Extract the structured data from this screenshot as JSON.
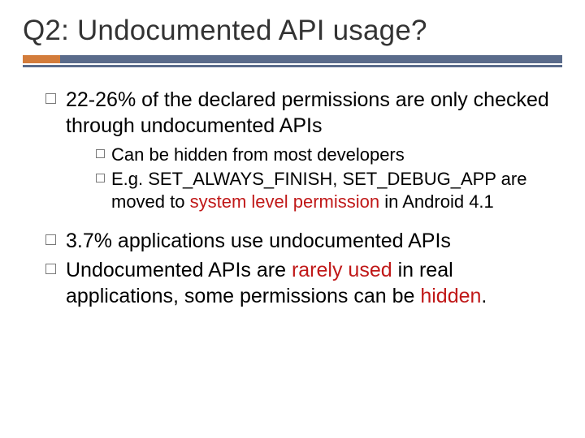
{
  "title": "Q2: Undocumented API usage?",
  "items": [
    {
      "text": "22-26% of the declared permissions are only checked through undocumented APIs",
      "sub": [
        {
          "text": "Can be hidden from most developers"
        },
        {
          "prefix": "E.g. SET_ALWAYS_FINISH, SET_DEBUG_APP are moved to ",
          "em": "system level permission",
          "suffix": " in Android 4.1"
        }
      ]
    },
    {
      "text": "3.7% applications use undocumented APIs"
    },
    {
      "prefix": "Undocumented APIs are ",
      "em": "rarely used",
      "mid": " in real applications, some permissions can be ",
      "em2": "hidden",
      "suffix": "."
    }
  ]
}
